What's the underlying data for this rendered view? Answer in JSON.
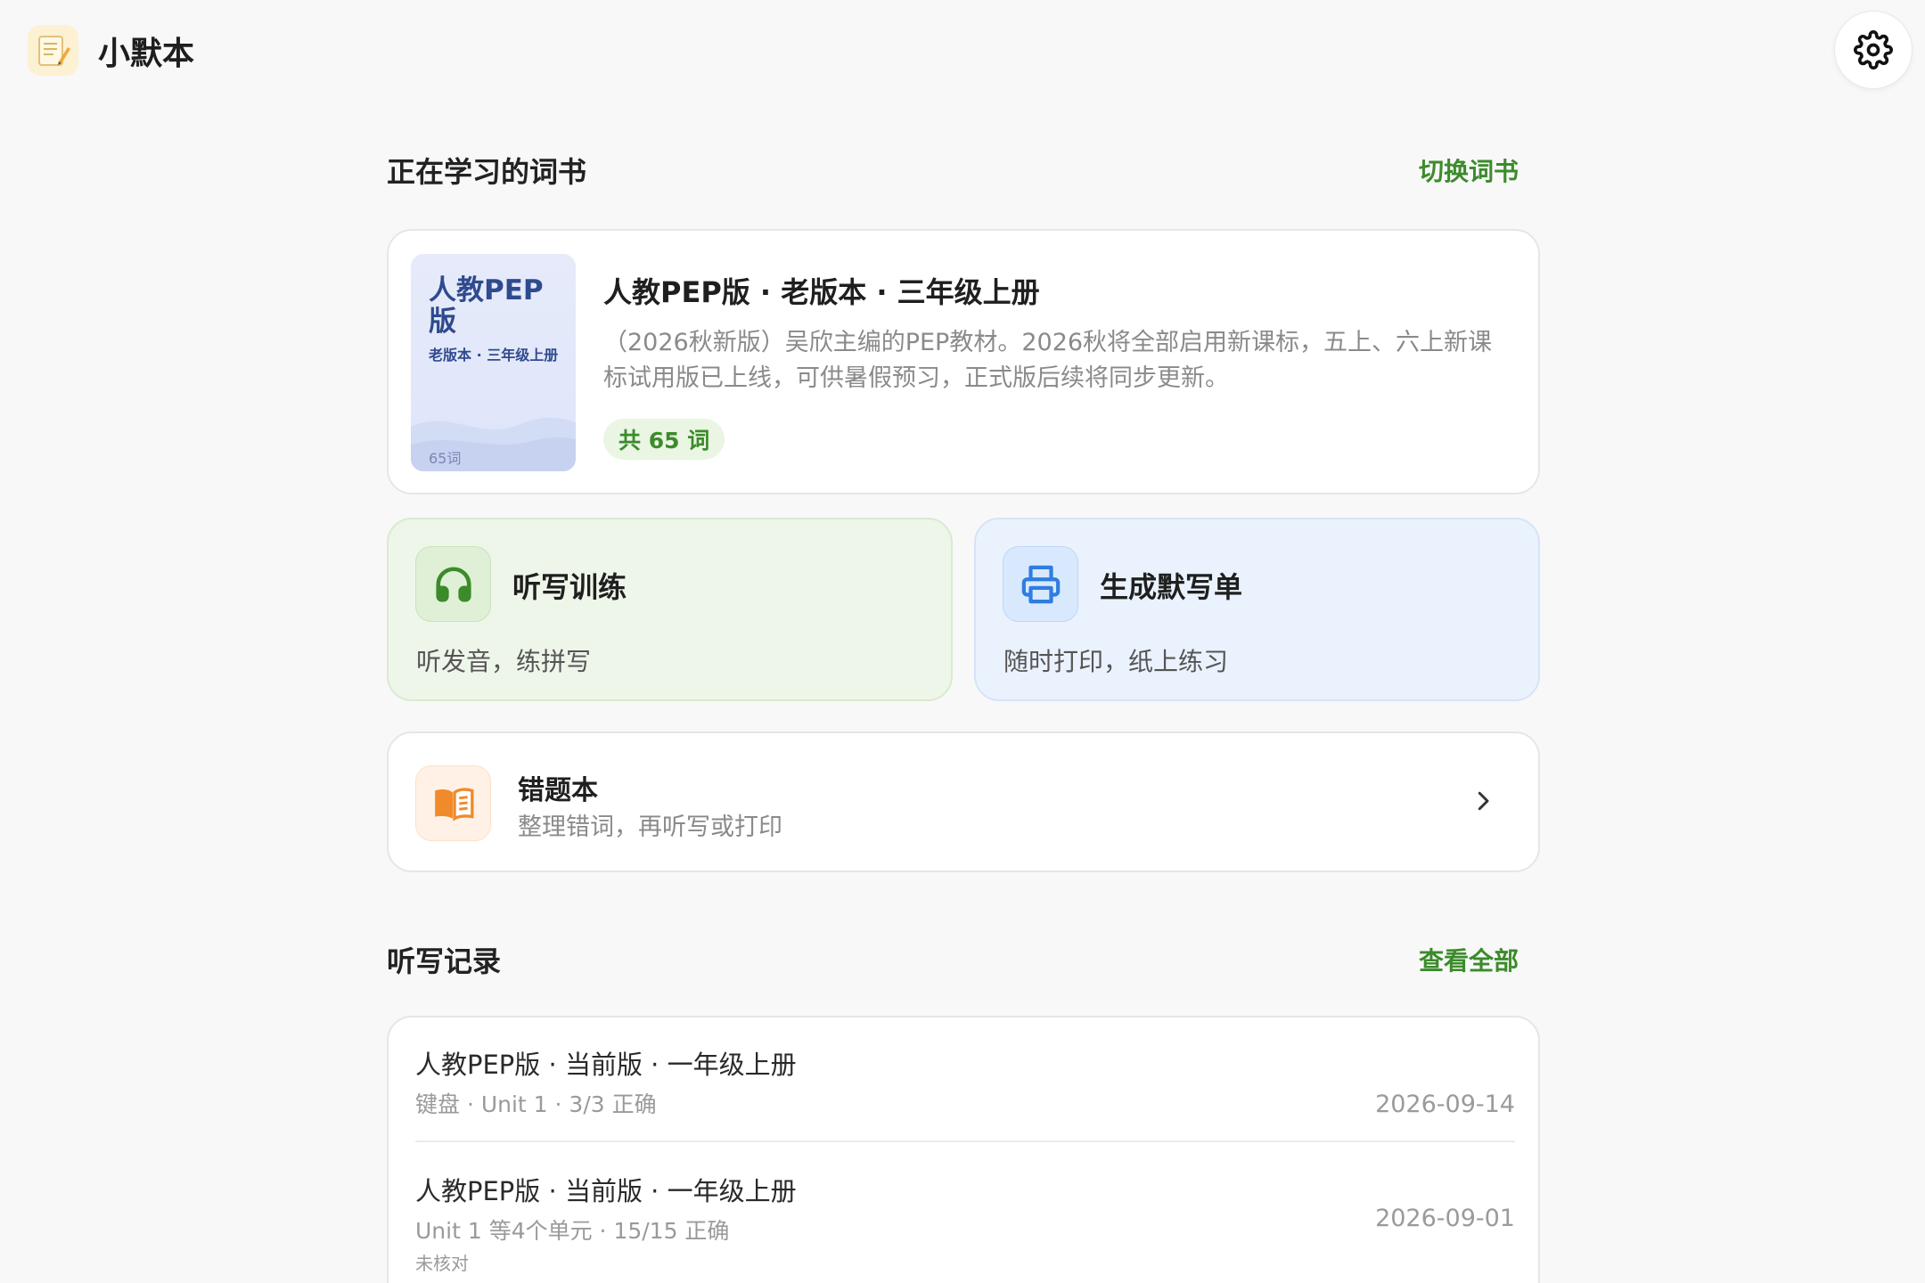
{
  "header": {
    "app_title": "小默本"
  },
  "current_book": {
    "section_title": "正在学习的词书",
    "switch_label": "切换词书",
    "cover_title": "人教PEP版",
    "cover_subtitle": "老版本 · 三年级上册",
    "cover_count": "65词",
    "title": "人教PEP版 · 老版本 · 三年级上册",
    "description": "（2026秋新版）吴欣主编的PEP教材。2026秋将全部启用新课标，五上、六上新课标试用版已上线，可供暑假预习，正式版后续将同步更新。",
    "word_count_label": "共 65 词"
  },
  "actions": {
    "dictation": {
      "title": "听写训练",
      "desc": "听发音，练拼写",
      "icon": "headphones-icon",
      "color": "#3c8b2b"
    },
    "print": {
      "title": "生成默写单",
      "desc": "随时打印，纸上练习",
      "icon": "printer-icon",
      "color": "#2f7de0"
    }
  },
  "wrong_book": {
    "title": "错题本",
    "desc": "整理错词，再听写或打印",
    "icon": "open-book-icon",
    "color": "#f08a2b"
  },
  "records": {
    "section_title": "听写记录",
    "view_all_label": "查看全部",
    "items": [
      {
        "title": "人教PEP版 · 当前版 · 一年级上册",
        "meta": "键盘 · Unit 1 · 3/3 正确",
        "note": "",
        "date": "2026-09-14"
      },
      {
        "title": "人教PEP版 · 当前版 · 一年级上册",
        "meta": "Unit 1 等4个单元 · 15/15 正确",
        "note": "未核对",
        "date": "2026-09-01"
      }
    ]
  },
  "colors": {
    "accent_green": "#3c8b2b",
    "accent_blue": "#2f7de0",
    "accent_orange": "#f08a2b"
  }
}
